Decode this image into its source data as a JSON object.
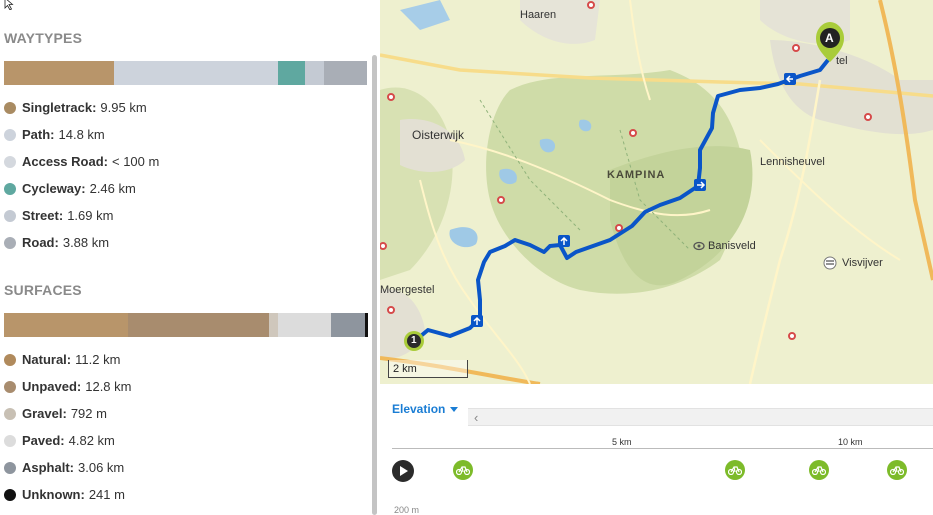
{
  "waytypes": {
    "title": "WAYTYPES",
    "segments": [
      {
        "color": "#b8956a",
        "fraction": 0.303
      },
      {
        "color": "#cdd3dc",
        "fraction": 0.45
      },
      {
        "color": "#5fa8a0",
        "fraction": 0.075
      },
      {
        "color": "#c4cad3",
        "fraction": 0.051
      },
      {
        "color": "#a9aeb6",
        "fraction": 0.118
      }
    ],
    "items": [
      {
        "label": "Singletrack:",
        "value": "9.95 km",
        "color": "#a98b62"
      },
      {
        "label": "Path:",
        "value": "14.8 km",
        "color": "#cdd3dc"
      },
      {
        "label": "Access Road:",
        "value": "< 100 m",
        "color": "#d4d8de"
      },
      {
        "label": "Cycleway:",
        "value": "2.46 km",
        "color": "#5fa8a0"
      },
      {
        "label": "Street:",
        "value": "1.69 km",
        "color": "#c4cad3"
      },
      {
        "label": "Road:",
        "value": "3.88 km",
        "color": "#a9aeb6"
      }
    ]
  },
  "surfaces": {
    "title": "SURFACES",
    "segments": [
      {
        "color": "#b8956a",
        "fraction": 0.34
      },
      {
        "color": "#a88c6e",
        "fraction": 0.389
      },
      {
        "color": "#cfc7bc",
        "fraction": 0.024
      },
      {
        "color": "#dcdcdc",
        "fraction": 0.146
      },
      {
        "color": "#8e959e",
        "fraction": 0.093
      },
      {
        "color": "#111111",
        "fraction": 0.008
      }
    ],
    "items": [
      {
        "label": "Natural:",
        "value": "11.2 km",
        "color": "#b08a5c"
      },
      {
        "label": "Unpaved:",
        "value": "12.8 km",
        "color": "#a88c6e"
      },
      {
        "label": "Gravel:",
        "value": "792 m",
        "color": "#c8c0b4"
      },
      {
        "label": "Paved:",
        "value": "4.82 km",
        "color": "#dcdcdc"
      },
      {
        "label": "Asphalt:",
        "value": "3.06 km",
        "color": "#8e959e"
      },
      {
        "label": "Unknown:",
        "value": "241 m",
        "color": "#111111"
      }
    ]
  },
  "map": {
    "places": {
      "haaren": "Haaren",
      "oisterwijk": "Oisterwijk",
      "kampina": "KAMPINA",
      "lennisheuvel": "Lennisheuvel",
      "banisveld": "Banisveld",
      "visvijver": "Visvijver",
      "moergestel": "Moergestel",
      "boxtel_partial": "tel"
    },
    "start_marker": "A",
    "waypoint_marker": "1",
    "scale": "2 km",
    "route_color": "#0a55c8"
  },
  "elevation": {
    "header": "Elevation",
    "axis_labels": [
      "5 km",
      "10 km"
    ],
    "y_label": "200 m"
  },
  "icons": {
    "play": "play-icon",
    "bike": "bike-icon",
    "eye": "viewpoint-icon",
    "cursor": "cursor-icon"
  }
}
